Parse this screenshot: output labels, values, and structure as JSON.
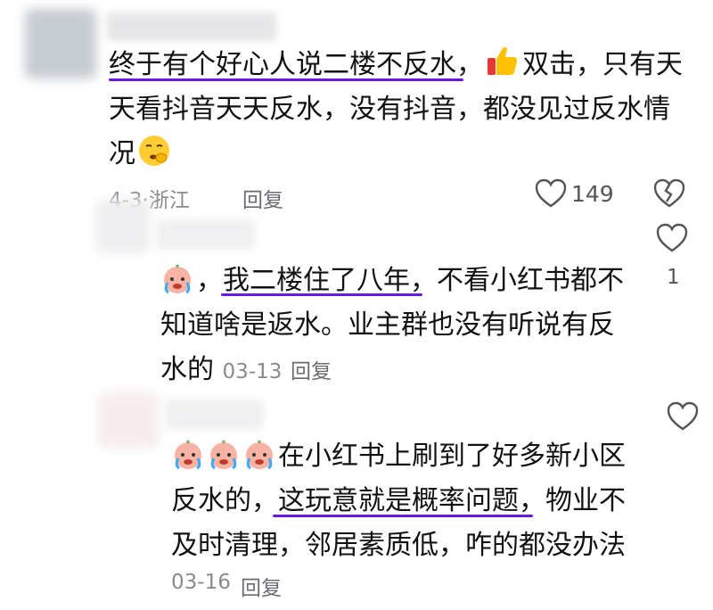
{
  "main_comment": {
    "line1_underlined": "终于有个好心人说二楼不反水，",
    "line1_rest": "双击，只有天",
    "line2": "天看抖音天天反水，没有抖音，都没见过反水情",
    "line3": "况",
    "date_location": "4-3·浙江",
    "reply_label": "回复",
    "like_count": "149"
  },
  "reply_1": {
    "text_before": "，",
    "text_underlined": "我二楼住了八年，",
    "text_line1_rest": "不看小红书都不",
    "text_line2": "知道啥是返水。业主群也没有听说有反",
    "text_line3": "水的",
    "date": "03-13",
    "reply_label": "回复",
    "like_count": "1"
  },
  "reply_2": {
    "text_line1": "在小红书上刷到了好多新小区",
    "text_line2_a": "反水的，",
    "text_line2_underlined": "这玩意就是概率问题，",
    "text_line2_b": "物业不",
    "text_line3": "及时清理，邻居素质低，咋的都没办法",
    "date": "03-16",
    "reply_label": "回复"
  },
  "colors": {
    "underline": "#6a17e0",
    "meta": "#8a8b91"
  }
}
